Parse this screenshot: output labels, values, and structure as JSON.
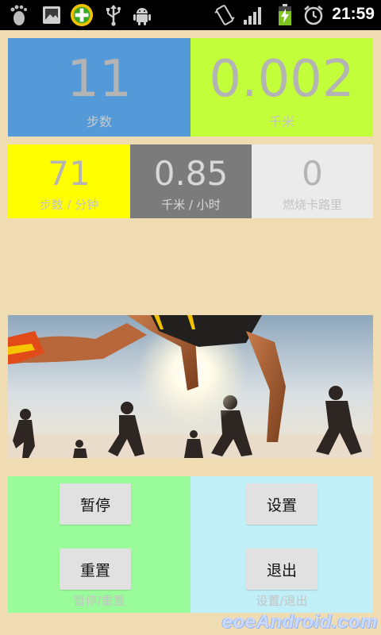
{
  "status_bar": {
    "time": "21:59",
    "icons": [
      "footprint-icon",
      "photo-icon",
      "security-plus-icon",
      "usb-icon",
      "android-debug-icon",
      "vibrate-icon",
      "signal-icon",
      "battery-charging-icon",
      "alarm-icon"
    ],
    "signal_bars": 4,
    "battery_level": 0.7
  },
  "stats": {
    "steps": {
      "value": "11",
      "label": "步数"
    },
    "distance": {
      "value": "0.002",
      "label": "千米"
    },
    "pace": {
      "value": "71",
      "label": "步数 / 分钟"
    },
    "speed": {
      "value": "0.85",
      "label": "千米 / 小时"
    },
    "calories": {
      "value": "0",
      "label": "燃烧卡路里"
    }
  },
  "controls": {
    "pause_label": "暂停",
    "reset_label": "重置",
    "left_caption": "暂停/重置",
    "settings_label": "设置",
    "exit_label": "退出",
    "right_caption": "设置/退出"
  },
  "watermark": "eoeAndroid.com",
  "colors": {
    "background": "#efdcb2",
    "steps_tile": "#559ad8",
    "distance_tile": "#c2ff3a",
    "pace_tile": "#ffff00",
    "speed_tile": "#7b7b7b",
    "calories_tile": "#ebebeb",
    "left_panel": "#99fb99",
    "right_panel": "#c0eff7"
  }
}
